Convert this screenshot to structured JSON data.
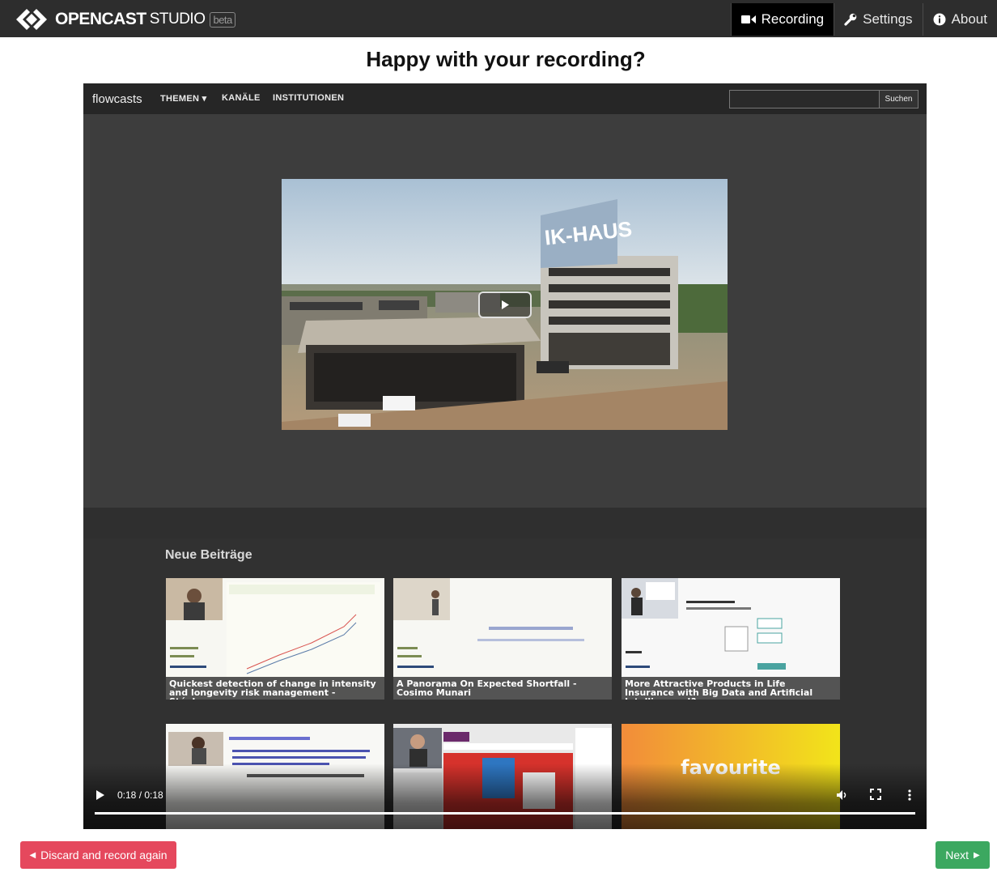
{
  "app": {
    "logo_bold": "OPENCAST",
    "logo_light": "STUDIO",
    "logo_badge": "beta"
  },
  "nav": {
    "items": [
      {
        "label": "Recording",
        "icon": "video-camera-icon",
        "active": true
      },
      {
        "label": "Settings",
        "icon": "wrench-icon",
        "active": false
      },
      {
        "label": "About",
        "icon": "info-circle-icon",
        "active": false
      }
    ]
  },
  "main": {
    "question": "Happy with your recording?"
  },
  "preview": {
    "site": {
      "brand": "flowcasts",
      "links": [
        "THEMEN ▾",
        "KANÄLE",
        "INSTITUTIONEN"
      ],
      "search_button": "Suchen"
    },
    "section_title": "Neue Beiträge",
    "cards": [
      {
        "caption": "Quickest detection of change in intensity and longevity risk management - Stéphan..."
      },
      {
        "caption": "A Panorama On Expected Shortfall - Cosimo Munari"
      },
      {
        "caption": "More Attractive Products in Life Insurance with Big Data and Artificial Intelligence !? ..."
      },
      {
        "caption": ""
      },
      {
        "caption": ""
      },
      {
        "caption": "favourite"
      }
    ],
    "player": {
      "time": "0:18 / 0:18",
      "progress": 1.0
    }
  },
  "actions": {
    "discard_label": "Discard and record again",
    "next_label": "Next"
  },
  "colors": {
    "topbar": "#2d2d2d",
    "discard": "#e5485d",
    "next": "#3ca860"
  }
}
